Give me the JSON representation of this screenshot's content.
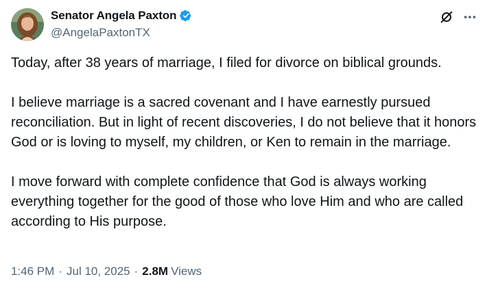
{
  "author": {
    "display_name": "Senator Angela Paxton",
    "handle": "@AngelaPaxtonTX",
    "verified": true,
    "verified_color": "#1d9bf0"
  },
  "icons": {
    "verified": "verified-badge-icon",
    "grok": "grok-icon",
    "more": "more-options-icon"
  },
  "tweet": {
    "paragraphs": [
      "Today, after 38 years of marriage, I filed for divorce on biblical grounds.",
      "I believe marriage is a sacred covenant and I have earnestly pursued reconciliation. But in light of recent discoveries, I do not believe that it honors God or is loving to myself, my children, or Ken to remain in the marriage.",
      "I move forward with complete confidence that God is always working everything together for the good of those who love Him and who are called according to His purpose."
    ]
  },
  "meta": {
    "time": "1:46 PM",
    "date": "Jul 10, 2025",
    "views_count": "2.8M",
    "views_label": "Views"
  },
  "colors": {
    "text": "#0f1419",
    "secondary": "#536471"
  }
}
